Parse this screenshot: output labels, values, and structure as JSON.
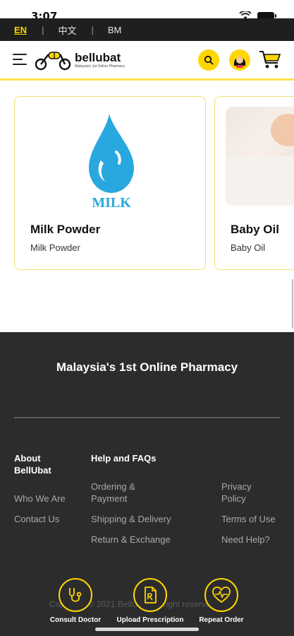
{
  "status": {
    "time": "3:07"
  },
  "lang_bar": {
    "en": "EN",
    "zh": "中文",
    "bm": "BM",
    "sep": "|"
  },
  "header": {
    "logo_word": "bellubat",
    "logo_sub": "Malaysia's 1st Online Pharmacy",
    "search_icon": "search-icon",
    "avatar_icon": "avatar-icon",
    "cart_icon": "cart-icon"
  },
  "products": [
    {
      "title": "Milk Powder",
      "subtitle": "Milk Powder",
      "image_text": "MILK"
    },
    {
      "title": "Baby Oil",
      "subtitle": "Baby Oil"
    }
  ],
  "footer": {
    "tagline": "Malaysia's 1st Online Pharmacy",
    "about": {
      "heading": "About BellUbat",
      "links": [
        "Who We Are",
        "Contact Us"
      ]
    },
    "help": {
      "heading": "Help and FAQs",
      "links": [
        "Ordering & Payment",
        "Shipping & Delivery",
        "Return & Exchange"
      ]
    },
    "other": {
      "links": [
        "Privacy Policy",
        "Terms of Use",
        "Need Help?"
      ]
    },
    "copyright": "Copyright © 2021 BellUbat All right reserved"
  },
  "quick_actions": [
    {
      "label": "Consult Doctor",
      "icon": "stethoscope-icon"
    },
    {
      "label": "Upload Prescription",
      "icon": "prescription-icon"
    },
    {
      "label": "Repeat Order",
      "icon": "heart-pulse-icon"
    }
  ],
  "colors": {
    "accent": "#ffd600",
    "footer_bg": "#2c2c2c",
    "lang_bar_bg": "#1f1f1f",
    "milk_blue": "#29a8e0"
  }
}
